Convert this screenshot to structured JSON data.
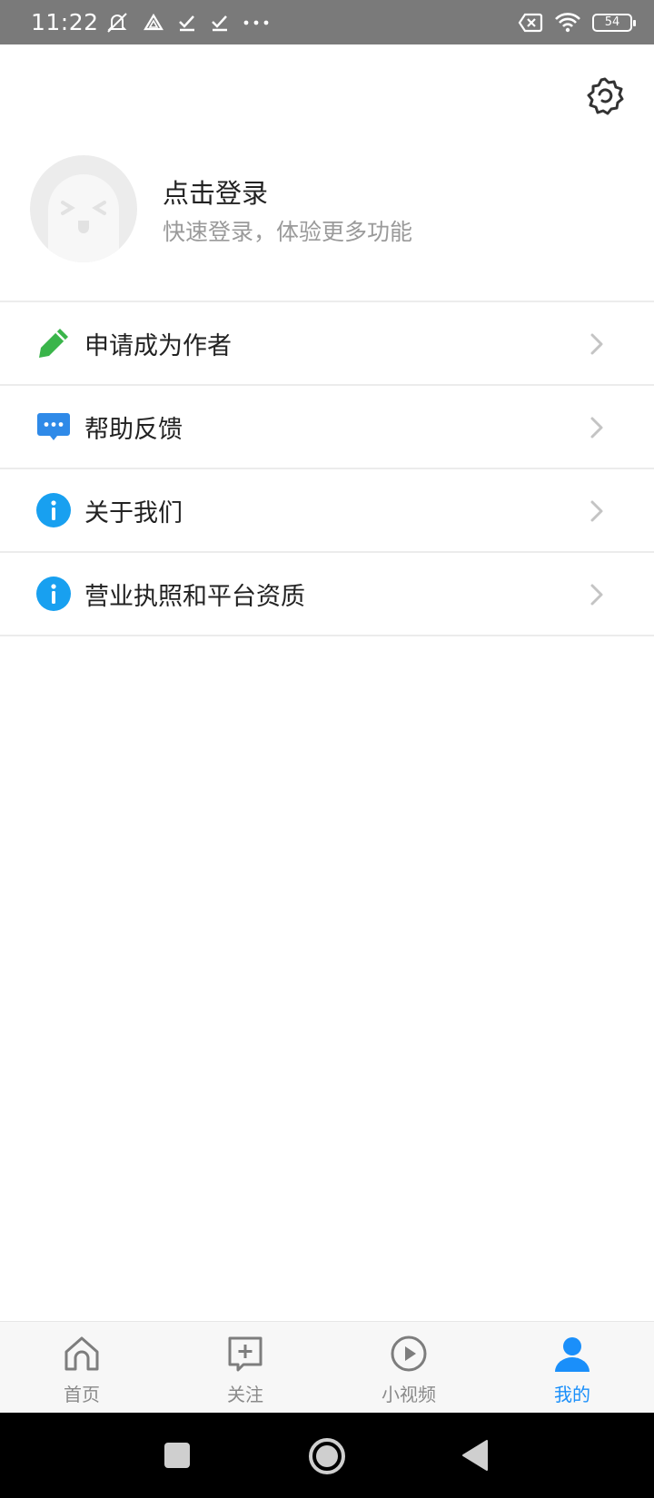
{
  "status_bar": {
    "time": "11:22",
    "battery": "54",
    "left_icons": [
      "mute-icon",
      "drive-icon",
      "check-icon",
      "check-icon",
      "more-dots-icon"
    ],
    "right_icons": [
      "sim-error-icon",
      "wifi-icon",
      "battery-icon"
    ]
  },
  "header": {
    "settings_icon": "settings-gear-icon"
  },
  "profile": {
    "avatar_icon": "ghost-avatar-icon",
    "title": "点击登录",
    "subtitle": "快速登录，体验更多功能"
  },
  "menu": {
    "items": [
      {
        "label": "申请成为作者",
        "icon": "pencil-icon",
        "color": "#3ab54a"
      },
      {
        "label": "帮助反馈",
        "icon": "chat-bubble-icon",
        "color": "#2f8ae8"
      },
      {
        "label": "关于我们",
        "icon": "info-icon",
        "color": "#18a0f0"
      },
      {
        "label": "营业执照和平台资质",
        "icon": "info-icon",
        "color": "#18a0f0"
      }
    ]
  },
  "tabbar": {
    "active_color": "#1a8ffa",
    "tabs": [
      {
        "label": "首页",
        "icon": "home-icon"
      },
      {
        "label": "关注",
        "icon": "add-square-icon"
      },
      {
        "label": "小视频",
        "icon": "play-circle-icon"
      },
      {
        "label": "我的",
        "icon": "user-icon",
        "active": true
      }
    ]
  },
  "nav_bar": {
    "buttons": [
      "recents-button",
      "home-button",
      "back-button"
    ]
  }
}
